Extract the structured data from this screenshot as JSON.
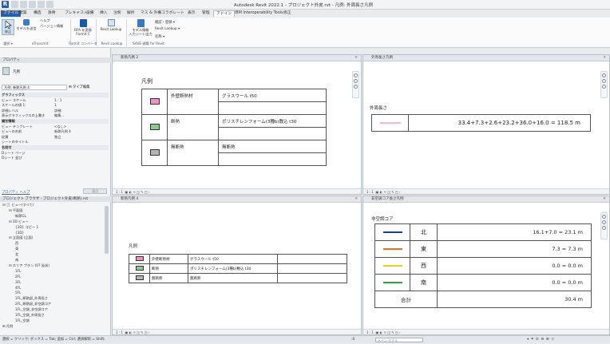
{
  "app_title": "Autodesk Revit 2022.1 - プロジェクト外皮.rvt - 凡例: 外周長さ凡例",
  "ribbon_tabs": [
    "ファイル",
    "建築",
    "構造",
    "鉄骨",
    "プレキャスト",
    "設備",
    "挿入",
    "注釈",
    "解析",
    "マス & 外構",
    "コラボレート",
    "表示",
    "管理",
    "アドイン",
    "IBM Interoperability Tools",
    "修正"
  ],
  "ribbon": {
    "buttons": [
      {
        "label": "修正",
        "icon": "modify-icon"
      },
      {
        "label": "モデルを送信",
        "icon": "send-model-icon"
      },
      {
        "label": "ヘルプ",
        "icon": "help-icon"
      },
      {
        "label": "バージョン情報",
        "icon": "version-info-icon"
      },
      {
        "label": "RFA を変換\nFormit C",
        "icon": "rfa-convert-icon"
      },
      {
        "label": "Revit Lookup",
        "icon": "revit-lookup-icon"
      },
      {
        "label": "モデル情報\n入力シート出力",
        "icon": "model-info-sheet-icon"
      }
    ],
    "small_items": [
      "確認・登録 ▾",
      "Revit Lookup ▾",
      "名称 ▾"
    ],
    "groups": [
      "選択 ▾",
      "eTransmit",
      "Formit コンバータ",
      "Revit Lookup",
      "SAVE-建築 for Revit"
    ]
  },
  "left_panel": {
    "properties_title": "プロパティ",
    "type_name": "凡例",
    "instance_selector": "凡例: 新熱凡例 4",
    "edit_type": "タイプ編集",
    "rows": [
      {
        "k": "グラフィックス",
        "v": "",
        "cat": true
      },
      {
        "k": "ビュー スケール",
        "v": "1 : 1"
      },
      {
        "k": "スケールの値 1:",
        "v": "1"
      },
      {
        "k": "詳細レベル",
        "v": "詳細"
      },
      {
        "k": "表示グラフィックスの上書き",
        "v": "編集..."
      },
      {
        "k": "識別情報",
        "v": "",
        "cat": true
      },
      {
        "k": "ビュー テンプレート",
        "v": "<なし>"
      },
      {
        "k": "ビューの名前",
        "v": "新熱凡例 4"
      },
      {
        "k": "従属",
        "v": "独立"
      },
      {
        "k": "シートのタイトル",
        "v": ""
      },
      {
        "k": "名前付",
        "v": "",
        "cat": true
      },
      {
        "k": "Dシート ページ",
        "v": ""
      },
      {
        "k": "Dシート 並び",
        "v": ""
      }
    ],
    "help_link": "プロパティ ヘルプ",
    "apply": "適用",
    "browser_title": "プロジェクト ブラウザ - プロジェクト外皮(断熱).rvt",
    "tree": [
      {
        "t": "⊟ 📋 ビュー(すべて)",
        "d": 0
      },
      {
        "t": "⊟ 平面図",
        "d": 1
      },
      {
        "t": "新節GL",
        "d": 2
      },
      {
        "t": "⊟ 3D ビュー",
        "d": 1
      },
      {
        "t": "{3D} コピー 1",
        "d": 2
      },
      {
        "t": "{3D}",
        "d": 2
      },
      {
        "t": "⊟ 立面図 (立面)",
        "d": 1
      },
      {
        "t": "西",
        "d": 2
      },
      {
        "t": "東",
        "d": 2
      },
      {
        "t": "北",
        "d": 2
      },
      {
        "t": "南",
        "d": 2
      },
      {
        "t": "⊟ エリア プラン (07 延床)",
        "d": 1
      },
      {
        "t": "1FL",
        "d": 2
      },
      {
        "t": "2FL",
        "d": 2
      },
      {
        "t": "3FL",
        "d": 2
      },
      {
        "t": "4FL",
        "d": 2
      },
      {
        "t": "5FL",
        "d": 2
      },
      {
        "t": "1FL_断熱部_外周長さ",
        "d": 2
      },
      {
        "t": "2FL_断熱部_非空調コア",
        "d": 2
      },
      {
        "t": "1FL_空調_非空調コア",
        "d": 2
      },
      {
        "t": "1FL_空調_外周長さ",
        "d": 2
      },
      {
        "t": "1FL_空調",
        "d": 2
      },
      {
        "t": "⊞ 凡例",
        "d": 0
      }
    ]
  },
  "views": {
    "v1": {
      "tab": "新熱凡例 2",
      "title": "凡例",
      "rows": [
        {
          "color": "#f090c8",
          "label": "外壁断熱材",
          "material": "グラスウール t50"
        },
        {
          "color": "#8cc890",
          "label": "断熱",
          "material": "ポリスチレンフォーム(3種b)敷込 t30"
        },
        {
          "color": "#b4b4b4",
          "label": "無断熱",
          "material": "無断熱"
        }
      ],
      "scale": "1 : 1"
    },
    "v2": {
      "tab": "外周長さ凡例",
      "title": "外周長さ",
      "line_color": "#f4b4dc",
      "formula": "33.4+7.3+2.6+23.2+36.0+16.0 = 118.5 m",
      "scale": "1 : 1"
    },
    "v3": {
      "tab": "新熱凡例 4",
      "title": "凡例",
      "rows": [
        {
          "color": "#f090c8",
          "label": "外壁断熱材",
          "material": "グラスウール t50"
        },
        {
          "color": "#8cc890",
          "label": "断熱",
          "material": "ポリスチレンフォーム(3種b)敷込 t30"
        },
        {
          "color": "#b4b4b4",
          "label": "無断熱",
          "material": "無断熱"
        }
      ],
      "scale": "1 : 1"
    },
    "v4": {
      "tab": "非空調コア長さ凡例",
      "title": "非空調コア",
      "rows": [
        {
          "color": "#1c3e8c",
          "dir": "北",
          "value": "16.1+7.0 = 23.1 m"
        },
        {
          "color": "#f07020",
          "dir": "東",
          "value": "7.3 = 7.3 m"
        },
        {
          "color": "#e8d020",
          "dir": "西",
          "value": "0.0 = 0.0 m"
        },
        {
          "color": "#30a040",
          "dir": "南",
          "value": "0.0 = 0.0 m"
        }
      ],
      "total_label": "合計",
      "total_value": "30.4 m",
      "scale": "1 : 1"
    }
  },
  "status": {
    "text": "選択 = クリック; ボックス = Tab; 追加 = Ctrl; 選択解除 = Shift;",
    "model": "メイン モデル",
    "zero": ":0"
  }
}
